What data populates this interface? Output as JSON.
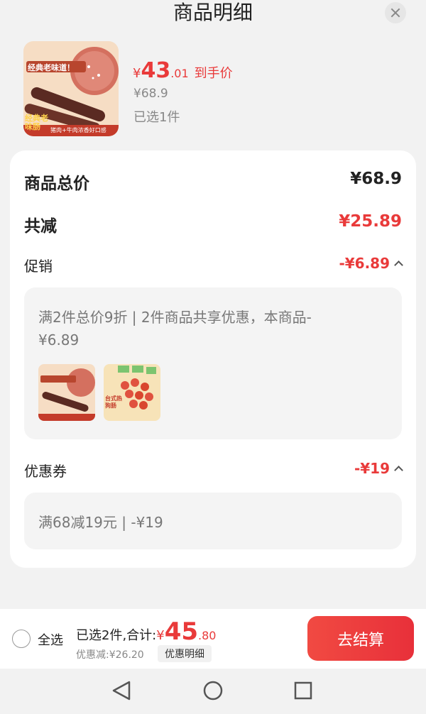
{
  "header": {
    "title": "商品明细"
  },
  "product": {
    "thumb_tagline": "经典老味道！",
    "thumb_badge": "经典老味肠",
    "thumb_sub": "猪肉+牛肉浓香好口感",
    "price_symbol": "¥",
    "price_int": "43",
    "price_dec": ".01",
    "price_suffix": "到手价",
    "original_price": "¥68.9",
    "selected_count": "已选1件"
  },
  "summary": {
    "total_label": "商品总价",
    "total_value": "¥68.9",
    "reduce_label": "共减",
    "reduce_value": "¥25.89"
  },
  "promotion": {
    "label": "促销",
    "value": "-¥6.89",
    "description": "满2件总价9折 | 2件商品共享优惠，本商品-¥6.89",
    "item2_badge": "台式热狗肠"
  },
  "coupon": {
    "label": "优惠券",
    "value": "-¥19",
    "description": "满68减19元 | -¥19"
  },
  "bottom": {
    "select_all": "全选",
    "selected_text": "已选2件,合计:",
    "total_symbol": "¥",
    "total_int": "45",
    "total_dec": ".80",
    "discount_text": "优惠减:¥26.20",
    "detail_label": "优惠明细",
    "checkout_label": "去结算"
  },
  "colors": {
    "accent": "#e93a3a",
    "background": "#f2f2f2"
  },
  "nav": {
    "back": "back-icon",
    "home": "home-icon",
    "recent": "recent-apps-icon"
  }
}
